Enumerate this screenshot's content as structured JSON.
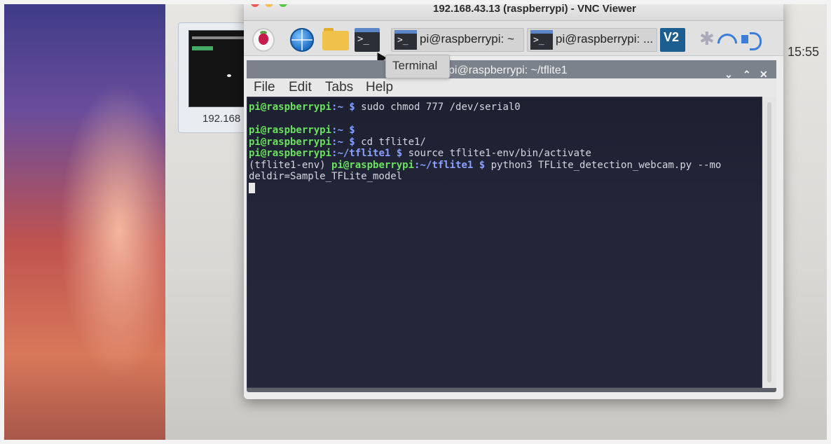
{
  "vnc": {
    "title": "192.168.43.13 (raspberrypi) - VNC Viewer"
  },
  "thumbnail": {
    "label": "192.168"
  },
  "panel": {
    "icons": [
      "raspberry-pi-menu-icon",
      "web-browser-icon",
      "file-manager-icon",
      "terminal-icon"
    ],
    "tasks": [
      {
        "label": "pi@raspberrypi: ~"
      },
      {
        "label": "pi@raspberrypi: ..."
      }
    ],
    "clock": "15:55",
    "tooltip": "Terminal"
  },
  "terminal": {
    "title": "pi@raspberrypi: ~/tflite1",
    "menu": [
      "File",
      "Edit",
      "Tabs",
      "Help"
    ],
    "lines": [
      {
        "user": "pi@raspberrypi",
        "path": ":~ $",
        "cmd": " sudo chmod 777 /dev/serial0"
      },
      {
        "user": "",
        "path": "",
        "cmd": ""
      },
      {
        "user": "pi@raspberrypi",
        "path": ":~ $",
        "cmd": ""
      },
      {
        "user": "pi@raspberrypi",
        "path": ":~ $",
        "cmd": " cd tflite1/"
      },
      {
        "user": "pi@raspberrypi",
        "path": ":~/tflite1 $",
        "cmd": " source tflite1-env/bin/activate"
      },
      {
        "prefix": "(tflite1-env) ",
        "user": "pi@raspberrypi",
        "path": ":~/tflite1 $",
        "cmd": " python3 TFLite_detection_webcam.py --mo"
      },
      {
        "user": "",
        "path": "",
        "cmd": "deldir=Sample_TFLite_model"
      }
    ]
  }
}
